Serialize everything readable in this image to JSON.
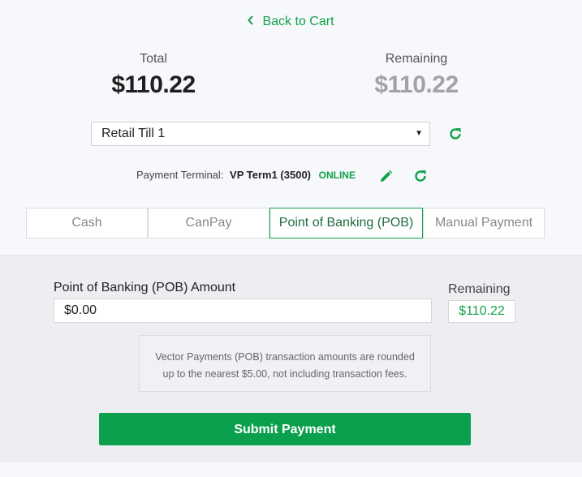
{
  "back_link": {
    "label": "Back to Cart",
    "icon": "chevron-left-icon"
  },
  "summary": {
    "total_label": "Total",
    "total_value": "$110.22",
    "remaining_label": "Remaining",
    "remaining_value": "$110.22"
  },
  "till": {
    "selected": "Retail Till 1"
  },
  "terminal": {
    "label": "Payment Terminal:",
    "name": "VP Term1 (3500)",
    "status": "ONLINE",
    "edit_icon": "pencil-icon",
    "refresh_icon": "refresh-icon"
  },
  "tabs": [
    {
      "label": "Cash",
      "active": false
    },
    {
      "label": "CanPay",
      "active": false
    },
    {
      "label": "Point of Banking (POB)",
      "active": true
    },
    {
      "label": "Manual Payment",
      "active": false
    }
  ],
  "pob": {
    "amount_label": "Point of Banking (POB) Amount",
    "amount_value": "$0.00",
    "remaining_label": "Remaining",
    "remaining_value": "$110.22",
    "note_line1": "Vector Payments (POB) transaction amounts are rounded",
    "note_line2": "up to the nearest $5.00, not including transaction fees.",
    "submit_label": "Submit Payment"
  },
  "colors": {
    "accent": "#12a14b",
    "button": "#0aa04d",
    "muted": "#a3a3a3"
  }
}
